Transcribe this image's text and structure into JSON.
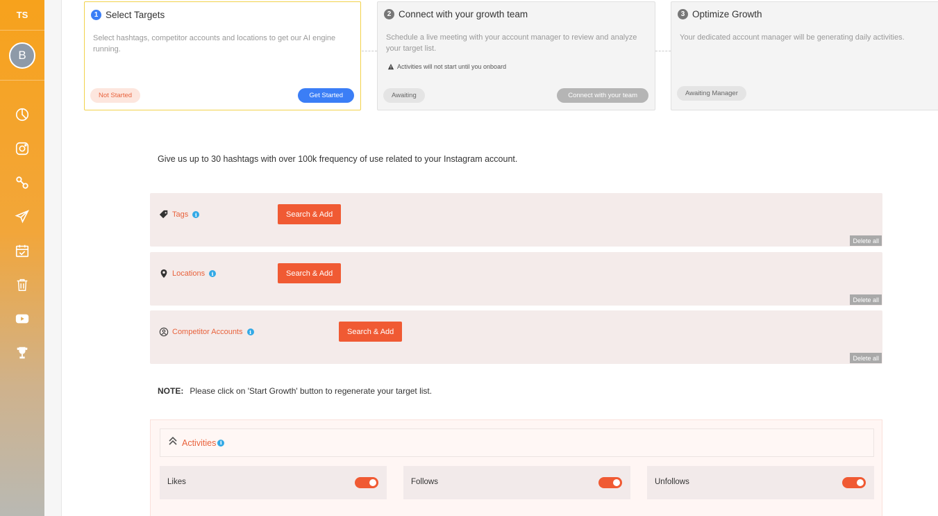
{
  "sidebar": {
    "brand": "TS",
    "avatar_letter": "B",
    "nav": [
      {
        "icon": "pie-chart-icon"
      },
      {
        "icon": "instagram-icon"
      },
      {
        "icon": "link-icon"
      },
      {
        "icon": "send-icon"
      },
      {
        "icon": "calendar-check-icon"
      },
      {
        "icon": "trash-icon"
      },
      {
        "icon": "youtube-icon"
      },
      {
        "icon": "trophy-icon"
      }
    ]
  },
  "steps": [
    {
      "num": "1",
      "title": "Select Targets",
      "desc": "Select hashtags, competitor accounts and locations to get our AI engine running.",
      "status": "Not Started",
      "action": "Get Started"
    },
    {
      "num": "2",
      "title": "Connect with your growth team",
      "desc": "Schedule a live meeting with your account manager to review and analyze your target list.",
      "warning": "Activities will not start until you onboard",
      "status": "Awaiting",
      "action": "Connect with your team"
    },
    {
      "num": "3",
      "title": "Optimize Growth",
      "desc": "Your dedicated account manager will be generating daily activities.",
      "status": "Awaiting Manager"
    }
  ],
  "intro": "Give us up to 30 hashtags with over 100k frequency of use related to your Instagram account.",
  "targets": [
    {
      "label": "Tags",
      "button": "Search & Add",
      "delete": "Delete all"
    },
    {
      "label": "Locations",
      "button": "Search & Add",
      "delete": "Delete all"
    },
    {
      "label": "Competitor Accounts",
      "button": "Search & Add",
      "delete": "Delete all"
    }
  ],
  "note": {
    "label": "NOTE:",
    "text": "Please click on 'Start Growth' button to regenerate your target list."
  },
  "activities": {
    "title": "Activities",
    "items": [
      {
        "label": "Likes",
        "enabled": true
      },
      {
        "label": "Follows",
        "enabled": true
      },
      {
        "label": "Unfollows",
        "enabled": true
      }
    ]
  },
  "colors": {
    "accent": "#f05a33",
    "primary": "#3b7ef6",
    "sidebar_top": "#f7a21c",
    "info": "#33a9e6"
  }
}
